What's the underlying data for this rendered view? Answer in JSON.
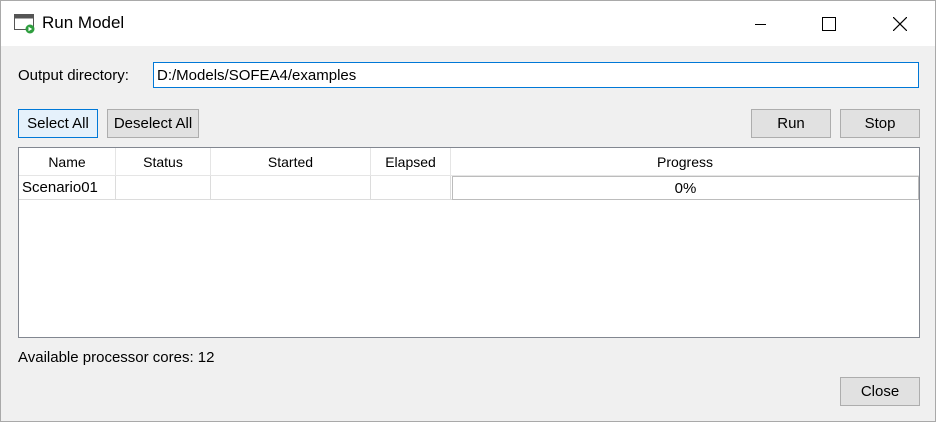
{
  "window": {
    "title": "Run Model",
    "icon": "window-app-icon"
  },
  "controls": {
    "minimize": "minimize-icon",
    "maximize": "maximize-icon",
    "close": "close-icon"
  },
  "output": {
    "label": "Output directory:",
    "value": "D:/Models/SOFEA4/examples"
  },
  "toolbar": {
    "select_all": "Select All",
    "deselect_all": "Deselect All",
    "run": "Run",
    "stop": "Stop"
  },
  "table": {
    "columns": [
      "Name",
      "Status",
      "Started",
      "Elapsed",
      "Progress"
    ],
    "rows": [
      {
        "name": "Scenario01",
        "status": "",
        "started": "",
        "elapsed": "",
        "progress": "0%"
      }
    ]
  },
  "footer": {
    "cores_label": "Available processor cores: 12",
    "close": "Close"
  },
  "colors": {
    "accent": "#0078d7",
    "dialog_bg": "#f0f0f0",
    "button_bg": "#e1e1e1"
  }
}
